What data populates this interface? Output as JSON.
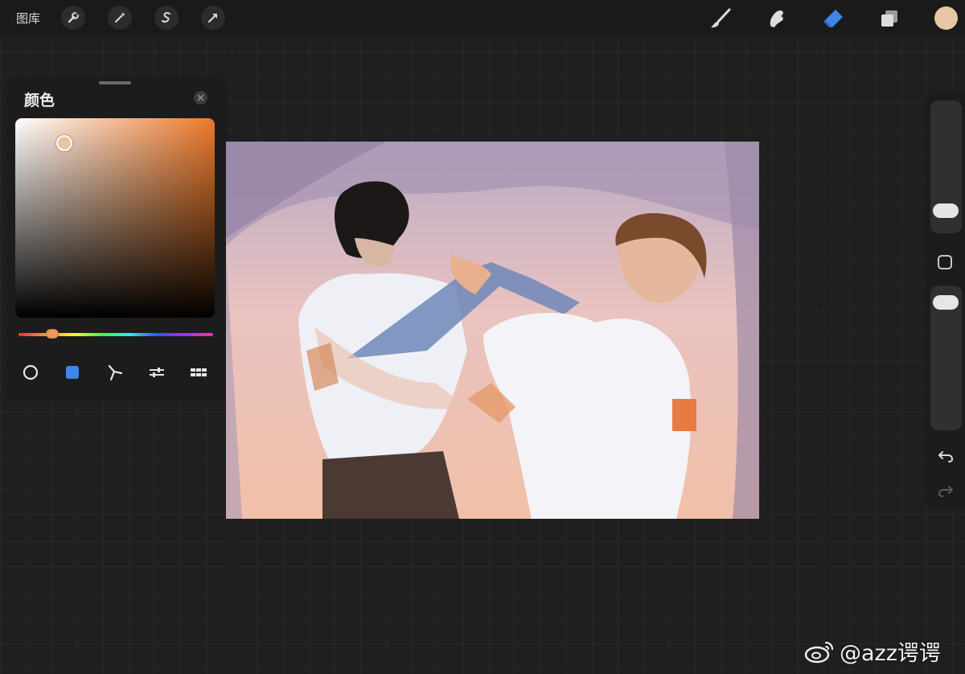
{
  "topbar": {
    "gallery_label": "图库",
    "left_tools": [
      "wrench-icon",
      "magic-wand-icon",
      "selection-icon",
      "transform-arrow-icon"
    ],
    "right_tools": [
      "brush-icon",
      "smudge-icon",
      "eraser-icon",
      "layers-icon"
    ],
    "active_tool": "eraser-icon",
    "current_color": "#e7c6a5"
  },
  "color_panel": {
    "title": "颜色",
    "hue_color": "#ec7a2a",
    "selected_color": "#e9c6a2",
    "modes": [
      "disc-mode-icon",
      "classic-mode-icon",
      "harmony-mode-icon",
      "value-mode-icon",
      "palettes-mode-icon"
    ],
    "active_mode": "classic-mode-icon"
  },
  "sidebar": {
    "brush_size": 0.15,
    "opacity": 0.95
  },
  "watermark": {
    "text": "@azz谔谔"
  }
}
